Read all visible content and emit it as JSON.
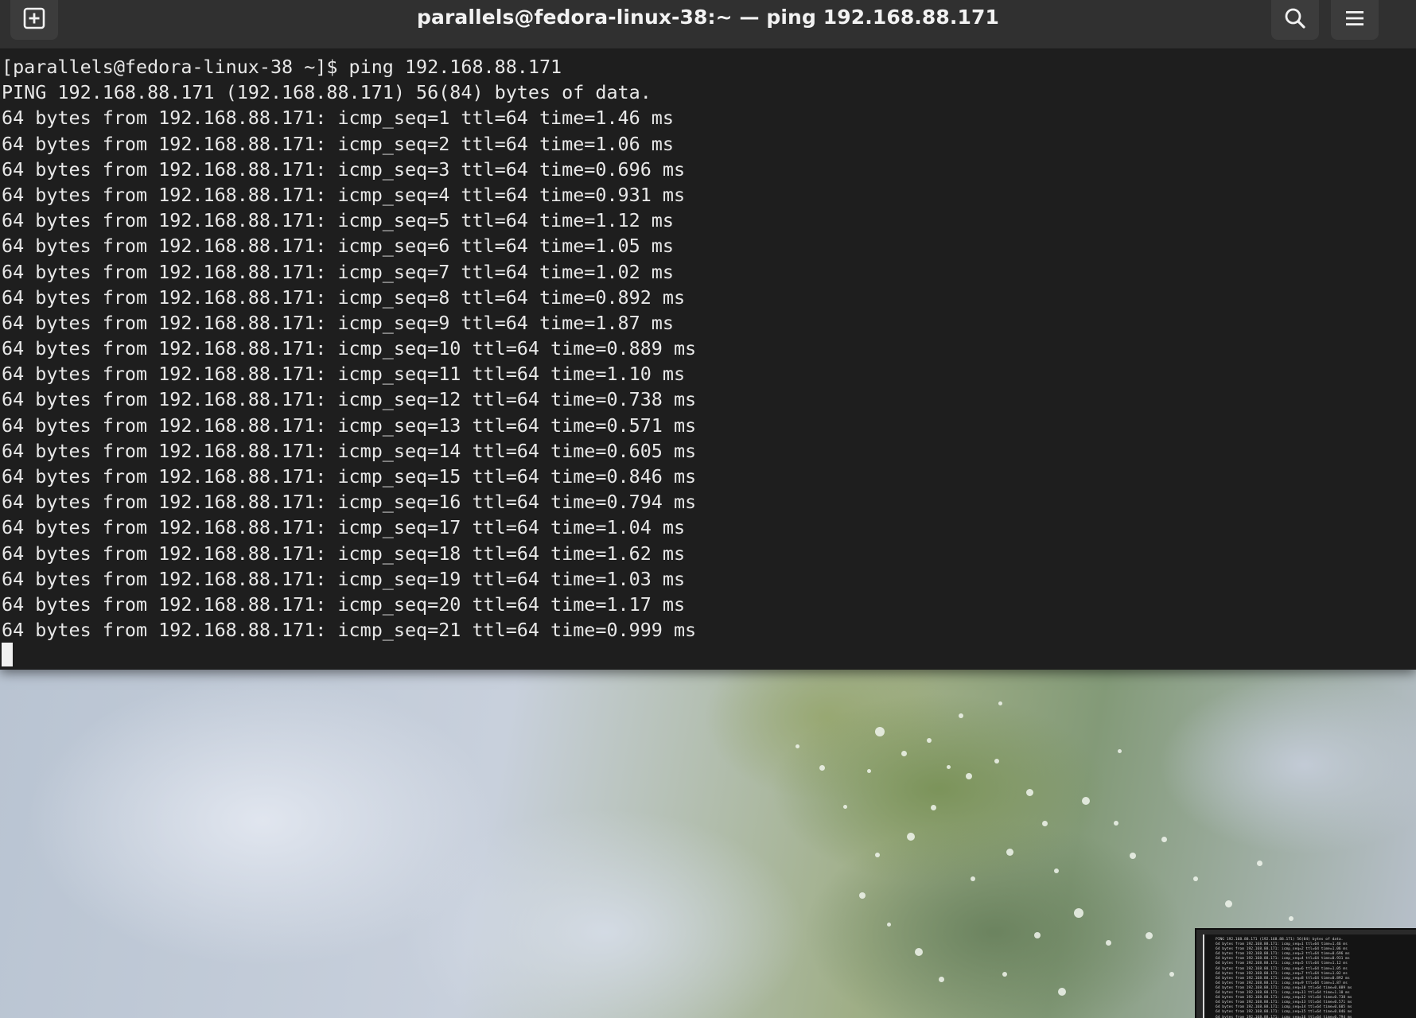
{
  "window": {
    "title": "parallels@fedora-linux-38:~ — ping 192.168.88.171"
  },
  "icons": {
    "new_tab": "new-tab-icon",
    "search": "search-icon",
    "menu": "hamburger-menu-icon"
  },
  "terminal": {
    "lines": [
      "[parallels@fedora-linux-38 ~]$ ping 192.168.88.171",
      "PING 192.168.88.171 (192.168.88.171) 56(84) bytes of data.",
      "64 bytes from 192.168.88.171: icmp_seq=1 ttl=64 time=1.46 ms",
      "64 bytes from 192.168.88.171: icmp_seq=2 ttl=64 time=1.06 ms",
      "64 bytes from 192.168.88.171: icmp_seq=3 ttl=64 time=0.696 ms",
      "64 bytes from 192.168.88.171: icmp_seq=4 ttl=64 time=0.931 ms",
      "64 bytes from 192.168.88.171: icmp_seq=5 ttl=64 time=1.12 ms",
      "64 bytes from 192.168.88.171: icmp_seq=6 ttl=64 time=1.05 ms",
      "64 bytes from 192.168.88.171: icmp_seq=7 ttl=64 time=1.02 ms",
      "64 bytes from 192.168.88.171: icmp_seq=8 ttl=64 time=0.892 ms",
      "64 bytes from 192.168.88.171: icmp_seq=9 ttl=64 time=1.87 ms",
      "64 bytes from 192.168.88.171: icmp_seq=10 ttl=64 time=0.889 ms",
      "64 bytes from 192.168.88.171: icmp_seq=11 ttl=64 time=1.10 ms",
      "64 bytes from 192.168.88.171: icmp_seq=12 ttl=64 time=0.738 ms",
      "64 bytes from 192.168.88.171: icmp_seq=13 ttl=64 time=0.571 ms",
      "64 bytes from 192.168.88.171: icmp_seq=14 ttl=64 time=0.605 ms",
      "64 bytes from 192.168.88.171: icmp_seq=15 ttl=64 time=0.846 ms",
      "64 bytes from 192.168.88.171: icmp_seq=16 ttl=64 time=0.794 ms",
      "64 bytes from 192.168.88.171: icmp_seq=17 ttl=64 time=1.04 ms",
      "64 bytes from 192.168.88.171: icmp_seq=18 ttl=64 time=1.62 ms",
      "64 bytes from 192.168.88.171: icmp_seq=19 ttl=64 time=1.03 ms",
      "64 bytes from 192.168.88.171: icmp_seq=20 ttl=64 time=1.17 ms",
      "64 bytes from 192.168.88.171: icmp_seq=21 ttl=64 time=0.999 ms"
    ]
  },
  "colors": {
    "terminal_bg": "#1e1e1e",
    "headerbar_bg": "#303030",
    "text": "#e8e8e8"
  }
}
